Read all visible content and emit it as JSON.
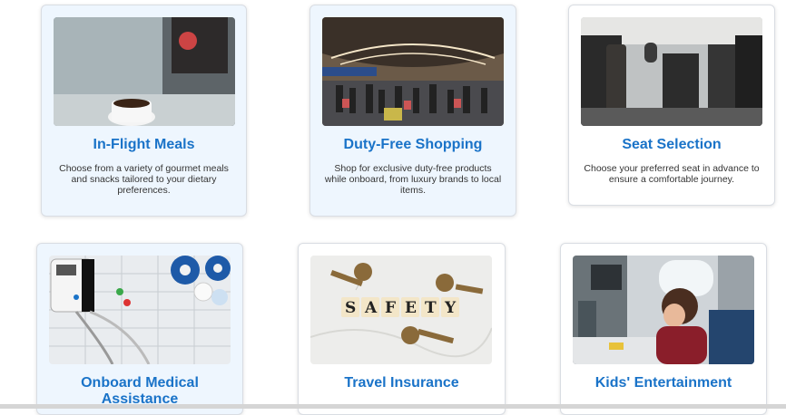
{
  "services": [
    {
      "title": "In-Flight Meals",
      "description": "Choose from a variety of gourmet meals and snacks tailored to your dietary preferences.",
      "image": "coffee-cup-on-tray-table-photo"
    },
    {
      "title": "Duty-Free Shopping",
      "description": "Shop for exclusive duty-free products while onboard, from luxury brands to local items.",
      "image": "busy-airport-terminal-photo"
    },
    {
      "title": "Seat Selection",
      "description": "Choose your preferred seat in advance to ensure a comfortable journey.",
      "image": "airplane-seats-photo"
    },
    {
      "title": "Onboard Medical Assistance",
      "description": "",
      "image": "medical-monitor-device-photo"
    },
    {
      "title": "Travel Insurance",
      "description": "",
      "image": "safety-letter-tiles-with-keys-photo"
    },
    {
      "title": "Kids' Entertainment",
      "description": "",
      "image": "child-playing-on-airplane-tray-photo"
    }
  ],
  "colors": {
    "title": "#1a73c8",
    "card_tint": "#eef6fe",
    "text": "#333333"
  }
}
